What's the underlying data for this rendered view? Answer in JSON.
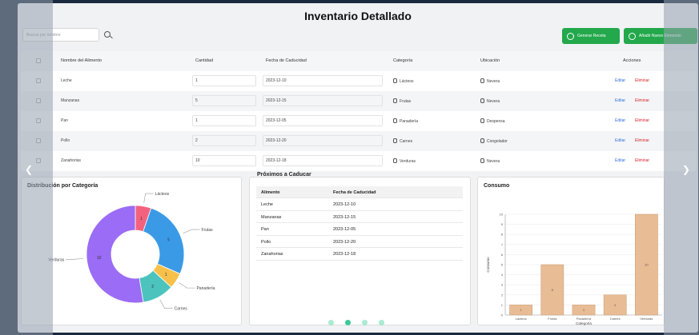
{
  "header": {
    "title": "Inventario Detallado"
  },
  "search": {
    "placeholder": "Buscar por nombre",
    "icon": "search-icon"
  },
  "toolbar": {
    "report_label": "Generar Receta",
    "add_label": "Añadir Nuevo Elemento",
    "accent": "#23a84c"
  },
  "table": {
    "columns": [
      "Nombre del Alimento",
      "Cantidad",
      "Fecha de Caducidad",
      "Categoría",
      "Ubicación",
      "Acciones"
    ],
    "rows": [
      {
        "name": "Leche",
        "qty": "1",
        "date": "2023-12-10",
        "category": "Lácteos",
        "cat_icon": "bottle-icon",
        "location": "Nevera",
        "loc_icon": "fridge-icon"
      },
      {
        "name": "Manzanas",
        "qty": "5",
        "date": "2023-12-15",
        "category": "Frutas",
        "cat_icon": "apple-icon",
        "location": "Nevera",
        "loc_icon": "fridge-icon"
      },
      {
        "name": "Pan",
        "qty": "1",
        "date": "2023-12-05",
        "category": "Panadería",
        "cat_icon": "bread-icon",
        "location": "Despensa",
        "loc_icon": "pantry-icon"
      },
      {
        "name": "Pollo",
        "qty": "2",
        "date": "2023-12-20",
        "category": "Carnes",
        "cat_icon": "drumstick-icon",
        "location": "Congelador",
        "loc_icon": "snowflake-icon"
      },
      {
        "name": "Zanahorias",
        "qty": "10",
        "date": "2023-12-18",
        "category": "Verduras",
        "cat_icon": "carrot-icon",
        "location": "Nevera",
        "loc_icon": "fridge-icon"
      }
    ],
    "actions": {
      "edit": "Editar",
      "delete": "Eliminar"
    }
  },
  "expiring": {
    "title": "Próximos a Caducar",
    "columns": [
      "Alimento",
      "Fecha de Caducidad"
    ],
    "rows": [
      {
        "name": "Leche",
        "date": "2023-12-10"
      },
      {
        "name": "Manzanas",
        "date": "2023-12-15"
      },
      {
        "name": "Pan",
        "date": "2023-12-05"
      },
      {
        "name": "Pollo",
        "date": "2023-12-20"
      },
      {
        "name": "Zanahorias",
        "date": "2023-12-18"
      }
    ]
  },
  "carousel": {
    "count": 4,
    "active": 1
  },
  "chart_data": [
    {
      "type": "pie",
      "title": "Distribución por Categoría",
      "categories": [
        "Lácteos",
        "Frutas",
        "Panadería",
        "Carnes",
        "Verduras"
      ],
      "values": [
        1,
        5,
        1,
        2,
        10
      ],
      "colors": [
        "#f2627f",
        "#3b9ae6",
        "#f6c14b",
        "#4cc3bd",
        "#9b6cf5"
      ]
    },
    {
      "type": "bar",
      "title": "Consumo",
      "categories": [
        "Lácteos",
        "Frutas",
        "Panadería",
        "Carnes",
        "Verduras"
      ],
      "values": [
        1,
        5,
        1,
        2,
        10
      ],
      "xlabel": "Categoría",
      "ylabel": "Consumo",
      "ylim": [
        0,
        10
      ],
      "yticks": [
        "0",
        "1",
        "2",
        "3",
        "4",
        "5",
        "6",
        "7",
        "8",
        "9",
        "10"
      ],
      "bar_color": "#e8bc95"
    }
  ]
}
